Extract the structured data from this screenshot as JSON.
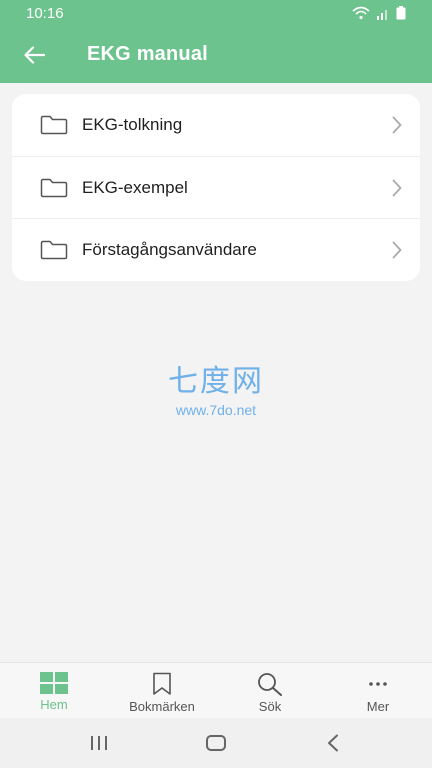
{
  "status_bar": {
    "time": "10:16"
  },
  "app_bar": {
    "title": "EKG manual",
    "back_icon": "arrow-left-icon"
  },
  "list": {
    "items": [
      {
        "label": "EKG-tolkning",
        "icon": "folder-icon"
      },
      {
        "label": "EKG-exempel",
        "icon": "folder-icon"
      },
      {
        "label": "Förstagångsanvändare",
        "icon": "folder-icon"
      }
    ]
  },
  "watermark": {
    "title": "七度网",
    "url": "www.7do.net"
  },
  "bottom_nav": {
    "items": [
      {
        "label": "Hem",
        "icon": "grid-icon",
        "active": true
      },
      {
        "label": "Bokmärken",
        "icon": "bookmark-icon",
        "active": false
      },
      {
        "label": "Sök",
        "icon": "search-icon",
        "active": false
      },
      {
        "label": "Mer",
        "icon": "more-icon",
        "active": false
      }
    ]
  },
  "colors": {
    "accent": "#6cc38e",
    "background": "#f3f3f3",
    "card": "#ffffff"
  }
}
